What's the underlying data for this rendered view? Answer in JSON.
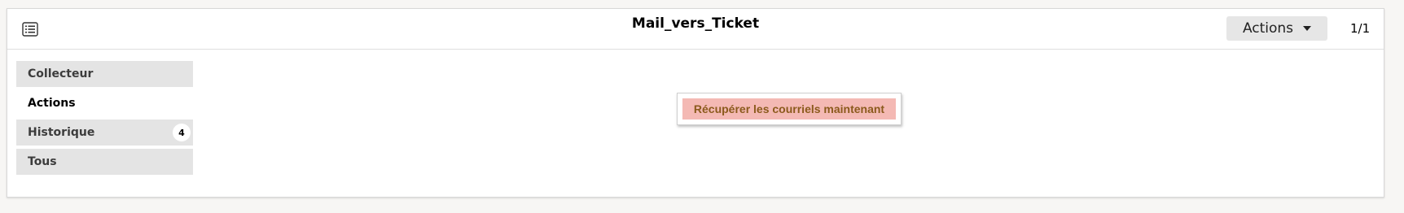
{
  "header": {
    "title": "Mail_vers_Ticket",
    "actions_label": "Actions",
    "pager": "1/1",
    "list_icon": "list-icon"
  },
  "tabs": [
    {
      "label": "Collecteur",
      "active": false
    },
    {
      "label": "Actions",
      "active": true
    },
    {
      "label": "Historique",
      "active": false,
      "count": "4"
    },
    {
      "label": "Tous",
      "active": false
    }
  ],
  "main": {
    "fetch_button_label": "Récupérer les courriels maintenant"
  },
  "colors": {
    "fetch_button_bg": "#f4b9b4",
    "fetch_button_text": "#8b5a1c",
    "tab_bg": "#e4e4e4"
  }
}
